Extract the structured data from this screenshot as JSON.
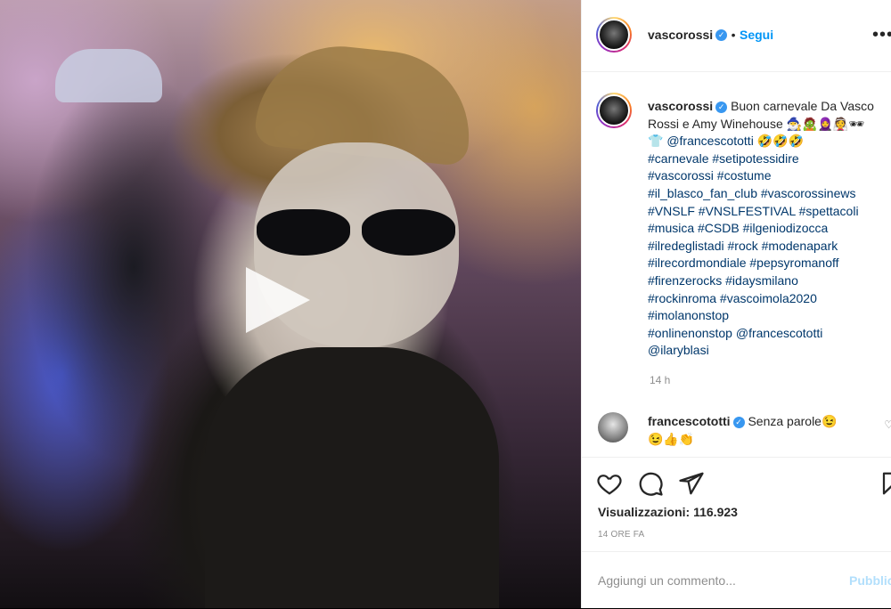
{
  "post": {
    "username": "vascorossi",
    "follow_label": "Segui",
    "more_label": "•••",
    "caption_text": "Buon carnevale Da Vasco Rossi e Amy Winehouse",
    "caption_emoji": "🧙‍♂️🧟🧕👰🕶",
    "caption_emoji2": "👕",
    "caption_mention": "@francescototti",
    "caption_laugh": "🤣🤣🤣",
    "hashtags": [
      "#carnevale #setipotessidire",
      "#vascorossi #costume",
      "#il_blasco_fan_club #vascorossinews",
      "#VNSLF #VNSLFESTIVAL #spettacoli",
      "#musica #CSDB #ilgeniodizocca",
      "#ilredeglistadi #rock #modenapark",
      "#ilrecordmondiale #pepsyromanoff",
      "#firenzerocks #idaysmilano",
      "#rockinroma #vascoimola2020",
      "#imolanonstop"
    ],
    "tail_tag": "#onlinenonstop",
    "tail_mention1": "@francescototti",
    "tail_mention2": "@ilaryblasi",
    "caption_time": "14 h"
  },
  "comment": {
    "username": "francescototti",
    "text": "Senza parole😉",
    "emoji": "😉👍👏"
  },
  "stats": {
    "views_label": "Visualizzazioni: 116.923",
    "time_ago": "14 ORE FA"
  },
  "composer": {
    "placeholder": "Aggiungi un commento...",
    "publish_label": "Pubblica"
  }
}
